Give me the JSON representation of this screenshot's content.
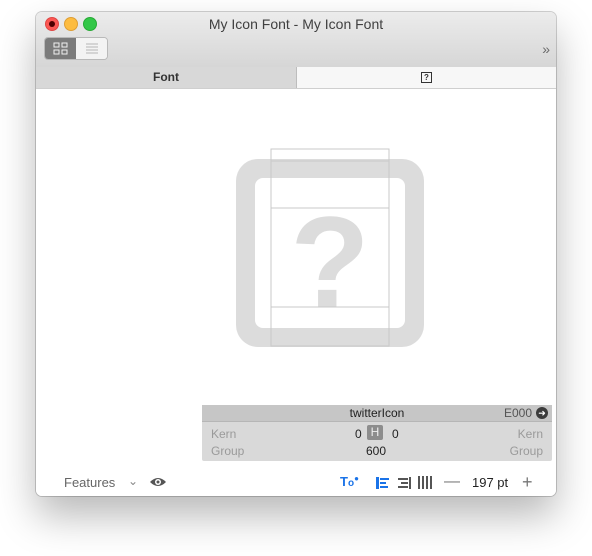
{
  "window": {
    "title": "My Icon Font - My Icon Font"
  },
  "tabs": [
    {
      "label": "Font",
      "active": true
    },
    {
      "label": "",
      "icon": "glyph-placeholder-icon",
      "active": false
    }
  ],
  "glyph_info": {
    "name": "twitterIcon",
    "unicode": "E000",
    "kern_label_left": "Kern",
    "kern_left": "0",
    "kern_right": "0",
    "kern_label_right": "Kern",
    "group_label_left": "Group",
    "width": "600",
    "group_label_right": "Group"
  },
  "bottom_bar": {
    "features_label": "Features",
    "size": "197 pt"
  },
  "colors": {
    "accent": "#1a73e8",
    "glyph_fill": "#dcdcdc",
    "guide_lines": "#c9c9c9"
  }
}
